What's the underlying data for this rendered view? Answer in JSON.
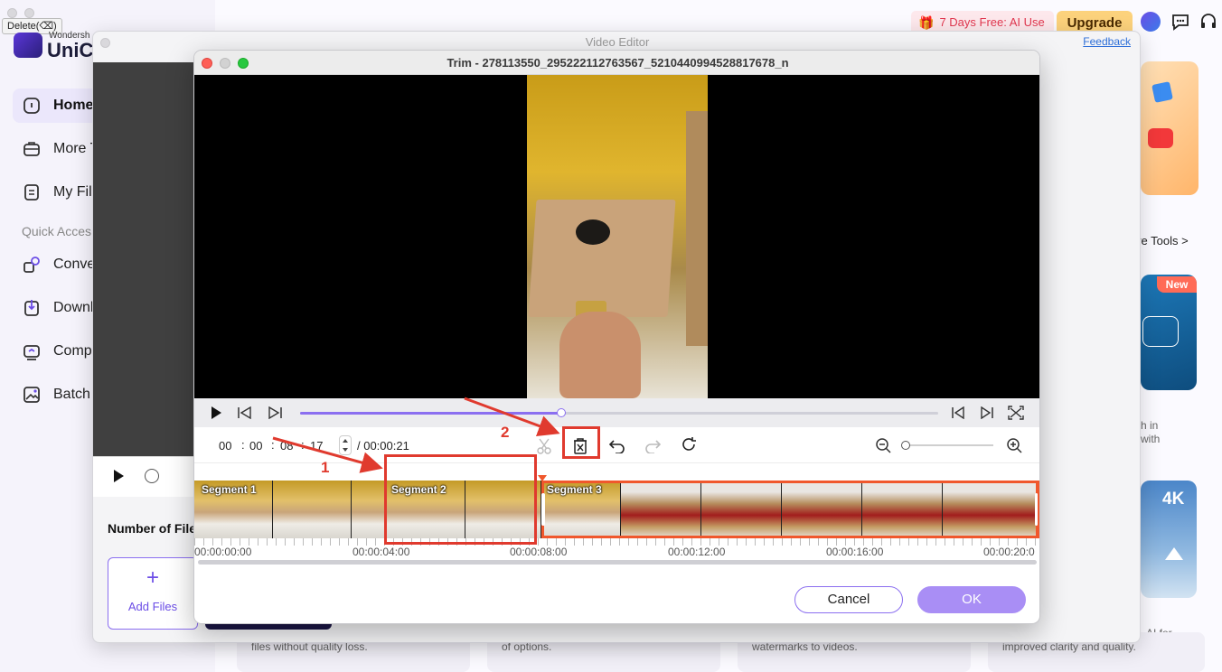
{
  "tooltip": "Delete(⌫)",
  "brand": {
    "small": "Wondersh",
    "name": "UniCo"
  },
  "sidebar": {
    "items": [
      {
        "label": "Home",
        "icon": "home-icon"
      },
      {
        "label": "More T",
        "icon": "toolbox-icon"
      },
      {
        "label": "My Fil",
        "icon": "file-icon"
      }
    ],
    "quick_access": "Quick Acces",
    "quick_items": [
      {
        "label": "Conve",
        "icon": "convert-icon"
      },
      {
        "label": "Downl",
        "icon": "download-icon"
      },
      {
        "label": "Comp",
        "icon": "compress-icon"
      },
      {
        "label": "Batch",
        "icon": "batch-image-icon"
      }
    ]
  },
  "topbar": {
    "free_label": "7 Days Free: AI Use",
    "upgrade_label": "Upgrade"
  },
  "right": {
    "more_tools": "ore Tools >",
    "new_badge": "New",
    "card_text_1": "h in",
    "card_text_2": "with",
    "badge_4k": "4K",
    "ai_text": "AI for"
  },
  "bottom": {
    "card1": "files without quality loss.",
    "card2": "of options.",
    "card3": "watermarks to videos.",
    "card4": "improved clarity and quality."
  },
  "video_editor": {
    "title": "Video Editor",
    "feedback": "Feedback",
    "number_of_files": "Number of File",
    "add_files": "Add Files"
  },
  "trim": {
    "title": "Trim - 278113550_295222112763567_5210440994528817678_n",
    "progress": 0.41,
    "timecode": {
      "hh": "00",
      "mm": "00",
      "ss": "08",
      "ff": "17",
      "total": "/ 00:00:21"
    },
    "zoom": 0,
    "segments": [
      "Segment 1",
      "Segment 2",
      "Segment 3"
    ],
    "ruler": [
      "00:00:00:00",
      "00:00:04:00",
      "00:00:08:00",
      "00:00:12:00",
      "00:00:16:00",
      "00:00:20:0"
    ],
    "cancel": "Cancel",
    "ok": "OK"
  },
  "annotations": {
    "step1": "1",
    "step2": "2",
    "accent": "#e03a2e"
  },
  "colors": {
    "accent_purple": "#8b6ff0",
    "segment_selected": "#f0572c"
  }
}
